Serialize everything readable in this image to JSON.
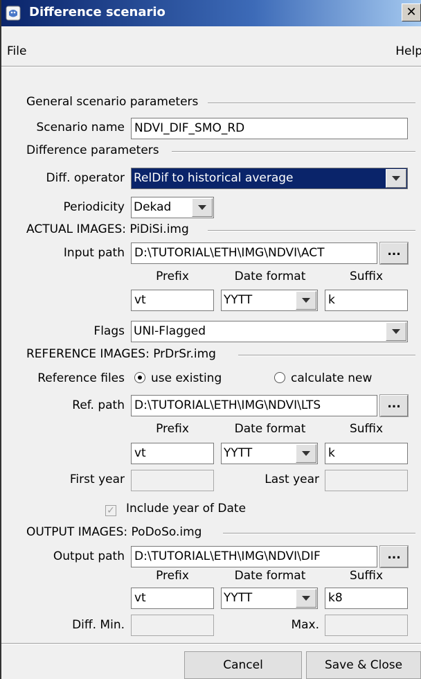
{
  "window": {
    "title": "Difference scenario",
    "close_glyph": "✕"
  },
  "menu": {
    "file": "File",
    "help": "Help"
  },
  "general": {
    "section": "General scenario parameters",
    "scenario_name_label": "Scenario name",
    "scenario_name_value": "NDVI_DIF_SMO_RD"
  },
  "difference": {
    "section": "Difference parameters",
    "operator_label": "Diff. operator",
    "operator_value": "RelDif to historical average",
    "periodicity_label": "Periodicity",
    "periodicity_value": "Dekad"
  },
  "actual": {
    "section": "ACTUAL IMAGES: PiDiSi.img",
    "input_path_label": "Input path",
    "input_path_value": "D:\\TUTORIAL\\ETH\\IMG\\NDVI\\ACT",
    "browse_label": "...",
    "prefix_header": "Prefix",
    "date_format_header": "Date format",
    "suffix_header": "Suffix",
    "prefix_value": "vt",
    "date_format_value": "YYTT",
    "suffix_value": "k",
    "flags_label": "Flags",
    "flags_value": "UNI-Flagged"
  },
  "reference": {
    "section": "REFERENCE IMAGES: PrDrSr.img",
    "files_label": "Reference files",
    "use_existing": "use existing",
    "calculate_new": "calculate new",
    "ref_path_label": "Ref. path",
    "ref_path_value": "D:\\TUTORIAL\\ETH\\IMG\\NDVI\\LTS",
    "browse_label": "...",
    "prefix_header": "Prefix",
    "date_format_header": "Date format",
    "suffix_header": "Suffix",
    "prefix_value": "vt",
    "date_format_value": "YYTT",
    "suffix_value": "k",
    "first_year_label": "First year",
    "last_year_label": "Last year",
    "include_year_label": "Include year of Date"
  },
  "output": {
    "section": "OUTPUT IMAGES: PoDoSo.img",
    "output_path_label": "Output path",
    "output_path_value": "D:\\TUTORIAL\\ETH\\IMG\\NDVI\\DIF",
    "browse_label": "...",
    "prefix_header": "Prefix",
    "date_format_header": "Date format",
    "suffix_header": "Suffix",
    "prefix_value": "vt",
    "date_format_value": "YYTT",
    "suffix_value": "k8",
    "diff_min_label": "Diff. Min.",
    "max_label": "Max."
  },
  "buttons": {
    "cancel": "Cancel",
    "save_close": "Save & Close"
  },
  "colors": {
    "titlebar": "#0a246a",
    "selection": "#0a246a",
    "dialog_bg": "#f0f0f0"
  }
}
